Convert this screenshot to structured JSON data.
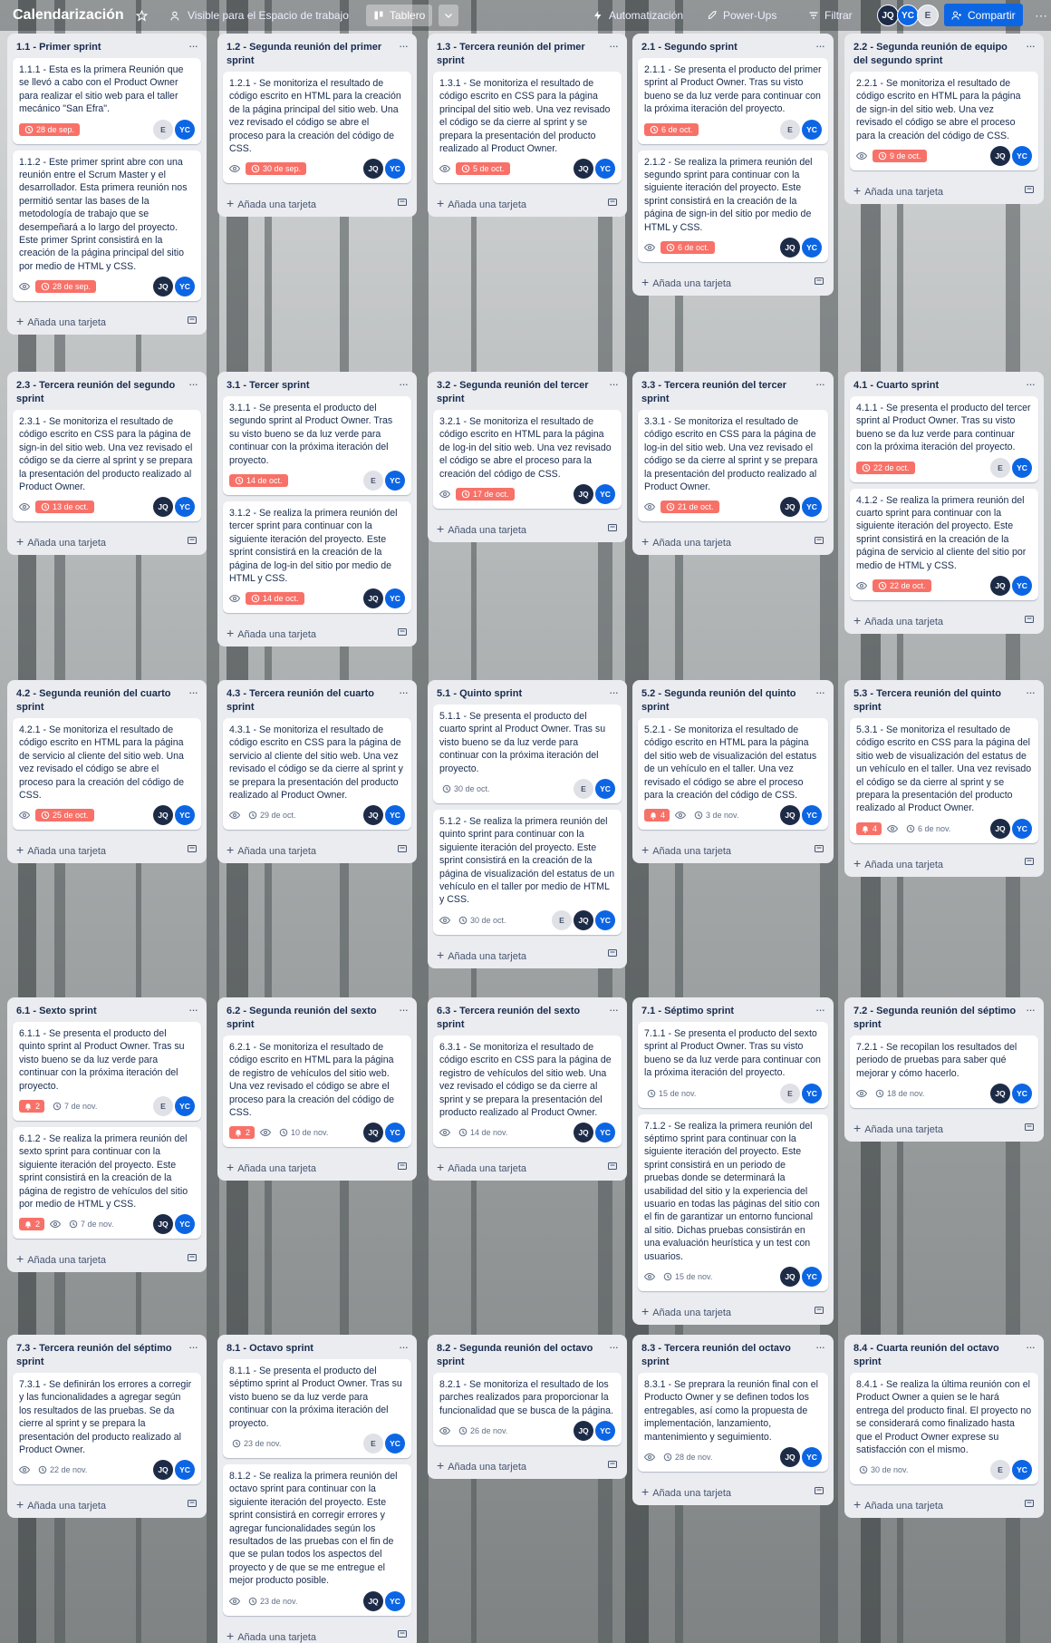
{
  "header": {
    "title": "Calendarización",
    "visibility": "Visible para el Espacio de trabajo",
    "view": "Tablero",
    "automation": "Automatización",
    "powerups": "Power-Ups",
    "filter": "Filtrar",
    "share": "Compartir",
    "members": [
      "JQ",
      "YC",
      "E"
    ]
  },
  "add_card": "Añada una tarjeta",
  "colors": {
    "due_overdue": "#f87168",
    "member_dark": "#1d2b46",
    "member_blue": "#0c66e4"
  },
  "lists": [
    {
      "title": "1.1 - Primer sprint",
      "cards": [
        {
          "text": "1.1.1 - Esta es la primera Reunión que se llevó a cabo con el Product Owner para realizar el sitio web para el taller mecánico \"San Efra\".",
          "eye": false,
          "due": "28 de sep.",
          "due_red": true,
          "members": [
            "E",
            "YC"
          ]
        },
        {
          "text": "1.1.2 - Este primer sprint abre con una reunión entre el Scrum Master y el desarrollador. Esta primera reunión nos permitió sentar las bases de la metodología de trabajo que se desempeñará a lo largo del proyecto. Este primer Sprint consistirá en la creación de la página principal del sitio por medio de HTML y CSS.",
          "eye": true,
          "due": "28 de sep.",
          "due_red": true,
          "members": [
            "JQ",
            "YC"
          ]
        }
      ]
    },
    {
      "title": "1.2 - Segunda reunión del primer sprint",
      "cards": [
        {
          "text": "1.2.1 - Se monitoriza el resultado de código escrito en HTML para la creación de la página principal del sitio web. Una vez revisado el código se abre el proceso para la creación del código de CSS.",
          "eye": true,
          "due": "30 de sep.",
          "due_red": true,
          "members": [
            "JQ",
            "YC"
          ]
        }
      ]
    },
    {
      "title": "1.3 - Tercera reunión del primer sprint",
      "cards": [
        {
          "text": "1.3.1 - Se monitoriza el resultado de código escrito en CSS para la página principal del sitio web. Una vez revisado el código se da cierre al sprint y se prepara la presentación del producto realizado al Product Owner.",
          "eye": true,
          "due": "5 de oct.",
          "due_red": true,
          "members": [
            "JQ",
            "YC"
          ]
        }
      ]
    },
    {
      "title": "2.1 - Segundo sprint",
      "cards": [
        {
          "text": "2.1.1 - Se presenta el producto del primer sprint al Product Owner. Tras su visto bueno se da luz verde para continuar con la próxima iteración del proyecto.",
          "eye": false,
          "due": "6 de oct.",
          "due_red": true,
          "members": [
            "E",
            "YC"
          ]
        },
        {
          "text": "2.1.2 - Se realiza la primera reunión del segundo sprint para continuar con la siguiente iteración del proyecto. Este sprint consistirá en la creación de la página de sign-in del sitio por medio de HTML y CSS.",
          "eye": true,
          "due": "6 de oct.",
          "due_red": true,
          "members": [
            "JQ",
            "YC"
          ]
        }
      ]
    },
    {
      "title": "2.2 - Segunda reunión de equipo del segundo sprint",
      "cards": [
        {
          "text": "2.2.1 - Se monitoriza el resultado de código escrito en HTML para la página de sign-in del sitio web. Una vez revisado el código se abre el proceso para la creación del código de CSS.",
          "eye": true,
          "due": "9 de oct.",
          "due_red": true,
          "members": [
            "JQ",
            "YC"
          ]
        }
      ]
    },
    {
      "title": "2.3 - Tercera reunión del segundo sprint",
      "cards": [
        {
          "text": "2.3.1 - Se monitoriza el resultado de código escrito en CSS para la página de sign-in del sitio web. Una vez revisado el código se da cierre al sprint y se prepara la presentación del producto realizado al Product Owner.",
          "eye": true,
          "due": "13 de oct.",
          "due_red": true,
          "members": [
            "JQ",
            "YC"
          ]
        }
      ]
    },
    {
      "title": "3.1 - Tercer sprint",
      "cards": [
        {
          "text": "3.1.1 - Se presenta el producto del segundo sprint al Product Owner. Tras su visto bueno se da luz verde para continuar con la próxima iteración del proyecto.",
          "eye": false,
          "due": "14 de oct.",
          "due_red": true,
          "members": [
            "E",
            "YC"
          ]
        },
        {
          "text": "3.1.2 - Se realiza la primera reunión del tercer sprint para continuar con la siguiente iteración del proyecto. Este sprint consistirá en la creación de la página de log-in del sitio por medio de HTML y CSS.",
          "eye": true,
          "due": "14 de oct.",
          "due_red": true,
          "members": [
            "JQ",
            "YC"
          ]
        }
      ]
    },
    {
      "title": "3.2 - Segunda reunión del tercer sprint",
      "cards": [
        {
          "text": "3.2.1 - Se monitoriza el resultado de código escrito en HTML para la página de log-in del sitio web. Una vez revisado el código se abre el proceso para la creación del código de CSS.",
          "eye": true,
          "due": "17 de oct.",
          "due_red": true,
          "members": [
            "JQ",
            "YC"
          ]
        }
      ]
    },
    {
      "title": "3.3 - Tercera reunión del tercer sprint",
      "cards": [
        {
          "text": "3.3.1 - Se monitoriza el resultado de código escrito en CSS para la página de log-in del sitio web. Una vez revisado el código se da cierre al sprint y se prepara la presentación del producto realizado al Product Owner.",
          "eye": true,
          "due": "21 de oct.",
          "due_red": true,
          "members": [
            "JQ",
            "YC"
          ]
        }
      ]
    },
    {
      "title": "4.1 - Cuarto sprint",
      "cards": [
        {
          "text": "4.1.1 - Se presenta el producto del tercer sprint al Product Owner. Tras su visto bueno se da luz verde para continuar con la próxima iteración del proyecto.",
          "eye": false,
          "due": "22 de oct.",
          "due_red": true,
          "members": [
            "E",
            "YC"
          ]
        },
        {
          "text": "4.1.2 - Se realiza la primera reunión del cuarto sprint para continuar con la siguiente iteración del proyecto. Este sprint consistirá en la creación de la página de servicio al cliente del sitio por medio de HTML y CSS.",
          "eye": true,
          "due": "22 de oct.",
          "due_red": true,
          "members": [
            "JQ",
            "YC"
          ]
        }
      ]
    },
    {
      "title": "4.2 - Segunda reunión del cuarto sprint",
      "cards": [
        {
          "text": "4.2.1 - Se monitoriza el resultado de código escrito en HTML para la página de servicio al cliente del sitio web. Una vez revisado el código se abre el proceso para la creación del código de CSS.",
          "eye": true,
          "due": "25 de oct.",
          "due_red": true,
          "members": [
            "JQ",
            "YC"
          ]
        }
      ]
    },
    {
      "title": "4.3 - Tercera reunión del cuarto sprint",
      "cards": [
        {
          "text": "4.3.1 - Se monitoriza el resultado de código escrito en CSS para la página de servicio al cliente del sitio web. Una vez revisado el código se da cierre al sprint y se prepara la presentación del producto realizado al Product Owner.",
          "eye": true,
          "due": "29 de oct.",
          "due_red": false,
          "members": [
            "JQ",
            "YC"
          ]
        }
      ]
    },
    {
      "title": "5.1 - Quinto sprint",
      "cards": [
        {
          "text": "5.1.1 - Se presenta el producto del cuarto sprint al Product Owner. Tras su visto bueno se da luz verde para continuar con la próxima iteración del proyecto.",
          "eye": false,
          "due": "30 de oct.",
          "due_red": false,
          "members": [
            "E",
            "YC"
          ]
        },
        {
          "text": "5.1.2 - Se realiza la primera reunión del quinto sprint para continuar con la siguiente iteración del proyecto. Este sprint consistirá en la creación de la página de visualización del estatus de un vehículo en el taller por medio de HTML y CSS.",
          "eye": true,
          "due": "30 de oct.",
          "due_red": false,
          "members": [
            "E",
            "JQ",
            "YC"
          ]
        }
      ]
    },
    {
      "title": "5.2 - Segunda reunión del quinto sprint",
      "cards": [
        {
          "text": "5.2.1 - Se monitoriza el resultado de código escrito en HTML para la página del sitio web de visualización del estatus de un vehículo en el taller. Una vez revisado el código se abre el proceso para la creación del código de CSS.",
          "bell": "4",
          "eye": true,
          "due": "3 de nov.",
          "due_red": false,
          "members": [
            "JQ",
            "YC"
          ]
        }
      ]
    },
    {
      "title": "5.3 - Tercera reunión del quinto sprint",
      "cards": [
        {
          "text": "5.3.1 - Se monitoriza el resultado de código escrito en CSS para la página del sitio web de visualización del estatus de un vehículo en el taller. Una vez revisado el código se da cierre al sprint y se prepara la presentación del producto realizado al Product Owner.",
          "bell": "4",
          "eye": true,
          "due": "6 de nov.",
          "due_red": false,
          "members": [
            "JQ",
            "YC"
          ]
        }
      ]
    },
    {
      "title": "6.1 - Sexto sprint",
      "cards": [
        {
          "text": "6.1.1 - Se presenta el producto del quinto sprint al Product Owner. Tras su visto bueno se da luz verde para continuar con la próxima iteración del proyecto.",
          "bell": "2",
          "eye": false,
          "due": "7 de nov.",
          "due_red": false,
          "members": [
            "E",
            "YC"
          ]
        },
        {
          "text": "6.1.2 - Se realiza la primera reunión del sexto sprint para continuar con la siguiente iteración del proyecto. Este sprint consistirá en la creación de la página de registro de vehículos del sitio por medio de HTML y CSS.",
          "bell": "2",
          "eye": true,
          "due": "7 de nov.",
          "due_red": false,
          "members": [
            "JQ",
            "YC"
          ]
        }
      ]
    },
    {
      "title": "6.2 - Segunda reunión del sexto sprint",
      "cards": [
        {
          "text": "6.2.1 - Se monitoriza el resultado de código escrito en HTML para la página de registro de vehículos del sitio web. Una vez revisado el código se abre el proceso para la creación del código de CSS.",
          "bell": "2",
          "eye": true,
          "due": "10 de nov.",
          "due_red": false,
          "members": [
            "JQ",
            "YC"
          ]
        }
      ]
    },
    {
      "title": "6.3 - Tercera reunión del sexto sprint",
      "cards": [
        {
          "text": "6.3.1 - Se monitoriza el resultado de código escrito en CSS para la página de registro de vehículos del sitio web. Una vez revisado el código se da cierre al sprint y se prepara la presentación del producto realizado al Product Owner.",
          "eye": true,
          "due": "14 de nov.",
          "due_red": false,
          "members": [
            "JQ",
            "YC"
          ]
        }
      ]
    },
    {
      "title": "7.1 - Séptimo sprint",
      "cards": [
        {
          "text": "7.1.1 - Se presenta el producto del sexto sprint al Product Owner. Tras su visto bueno se da luz verde para continuar con la próxima iteración del proyecto.",
          "eye": false,
          "due": "15 de nov.",
          "due_red": false,
          "members": [
            "E",
            "YC"
          ]
        },
        {
          "text": "7.1.2 - Se realiza la primera reunión del séptimo sprint para continuar con la siguiente iteración del proyecto. Este sprint consistirá en un periodo de pruebas donde se determinará la usabilidad del sitio y la experiencia del usuario en todas las páginas del sitio con el fin de garantizar un entorno funcional al sitio. Dichas pruebas consistirán en una evaluación heurística y un test con usuarios.",
          "eye": true,
          "due": "15 de nov.",
          "due_red": false,
          "members": [
            "JQ",
            "YC"
          ]
        }
      ]
    },
    {
      "title": "7.2 - Segunda reunión del séptimo sprint",
      "cards": [
        {
          "text": "7.2.1 - Se recopilan los resultados del periodo de pruebas para saber qué mejorar y cómo hacerlo.",
          "eye": true,
          "due": "18 de nov.",
          "due_red": false,
          "members": [
            "JQ",
            "YC"
          ]
        }
      ]
    },
    {
      "title": "7.3 - Tercera reunión del séptimo sprint",
      "cards": [
        {
          "text": "7.3.1 - Se definirán los errores a corregir y las funcionalidades a agregar según los resultados de las pruebas. Se da cierre al sprint y se prepara la presentación del producto realizado al Product Owner.",
          "eye": true,
          "due": "22 de nov.",
          "due_red": false,
          "members": [
            "JQ",
            "YC"
          ]
        }
      ]
    },
    {
      "title": "8.1 - Octavo sprint",
      "cards": [
        {
          "text": "8.1.1 - Se presenta el producto del séptimo sprint al Product Owner. Tras su visto bueno se da luz verde para continuar con la próxima iteración del proyecto.",
          "eye": false,
          "due": "23 de nov.",
          "due_red": false,
          "members": [
            "E",
            "YC"
          ]
        },
        {
          "text": "8.1.2 - Se realiza la primera reunión del octavo sprint para continuar con la siguiente iteración del proyecto. Este sprint consistirá en corregir errores y agregar funcionalidades según los resultados de las pruebas con el fin de que se pulan todos los aspectos del proyecto y de que se me entregue el mejor producto posible.",
          "eye": true,
          "due": "23 de nov.",
          "due_red": false,
          "members": [
            "JQ",
            "YC"
          ]
        }
      ]
    },
    {
      "title": "8.2 - Segunda reunión del octavo sprint",
      "cards": [
        {
          "text": "8.2.1 - Se monitoriza el resultado de los parches realizados para proporcionar la funcionalidad que se busca de la página.",
          "eye": true,
          "due": "26 de nov.",
          "due_red": false,
          "members": [
            "JQ",
            "YC"
          ]
        }
      ]
    },
    {
      "title": "8.3 - Tercera reunión del octavo sprint",
      "cards": [
        {
          "text": "8.3.1 - Se preprara la reunión final con el Producto Owner y se definen todos los entregables, así como la propuesta de implementación, lanzamiento, mantenimiento y seguimiento.",
          "eye": true,
          "due": "28 de nov.",
          "due_red": false,
          "members": [
            "JQ",
            "YC"
          ]
        }
      ]
    },
    {
      "title": "8.4 - Cuarta reunión del octavo sprint",
      "cards": [
        {
          "text": "8.4.1 - Se realiza la última reunión con el Product Owner a quien se le hará entrega del producto final. El proyecto no se considerará como finalizado hasta que el Product Owner exprese su satisfacción con el mismo.",
          "eye": false,
          "due": "30 de nov.",
          "due_red": false,
          "members": [
            "E",
            "YC"
          ]
        }
      ]
    }
  ]
}
